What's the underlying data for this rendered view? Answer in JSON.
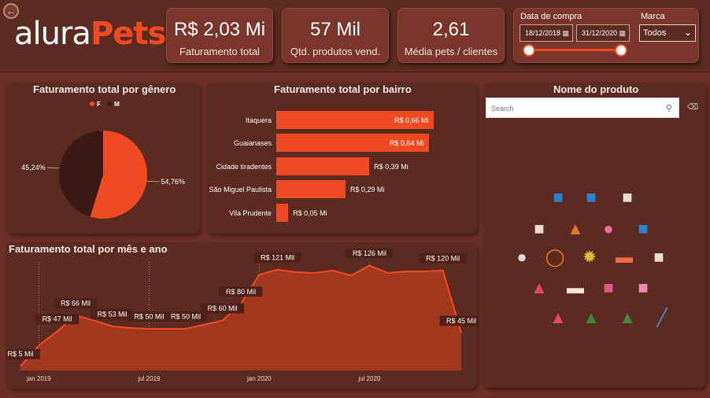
{
  "logo": {
    "part1": "alura",
    "part2": "Pets"
  },
  "kpis": [
    {
      "value": "R$ 2,03 Mi",
      "label": "Faturamento total"
    },
    {
      "value": "57 Mil",
      "label": "Qtd. produtos vend."
    },
    {
      "value": "2,61",
      "label": "Média pets / clientes"
    }
  ],
  "filters": {
    "date_label": "Data de compra",
    "date_start": "18/12/2018",
    "date_end": "31/12/2020",
    "brand_label": "Marca",
    "brand_value": "Todos",
    "date_range_fraction": [
      0.0,
      1.0
    ]
  },
  "gender_panel": {
    "title": "Faturamento total por gênero",
    "legend": [
      {
        "label": "F",
        "color": "#f04a23"
      },
      {
        "label": "M",
        "color": "#3a1813"
      }
    ],
    "slices": [
      {
        "label": "F",
        "value": 54.76,
        "text": "54,76%",
        "color": "#f04a23"
      },
      {
        "label": "M",
        "value": 45.24,
        "text": "45,24%",
        "color": "#3a1813"
      }
    ]
  },
  "bairro_panel": {
    "title": "Faturamento total por bairro",
    "rows": [
      {
        "name": "Itaquera",
        "value": 0.66,
        "text": "R$ 0,66 Mi"
      },
      {
        "name": "Guaianases",
        "value": 0.64,
        "text": "R$ 0,64 Mi"
      },
      {
        "name": "Cidade tiradentes",
        "value": 0.39,
        "text": "R$ 0,39 Mi"
      },
      {
        "name": "São Miguel Paulista",
        "value": 0.29,
        "text": "R$ 0,29 Mi"
      },
      {
        "name": "Vila Prudente",
        "value": 0.05,
        "text": "R$ 0,05 Mi"
      }
    ]
  },
  "product_panel": {
    "title": "Nome do produto",
    "search_placeholder": "Search",
    "icons": [
      "dog-food-bag-icon",
      "dog-food-bag-icon",
      "dog-treat-jar-icon",
      "dog-treat-jar-icon",
      "dog-sweater-icon",
      "pet-tag-icon",
      "dog-food-bag-icon",
      "mouse-toy-icon",
      "dog-collar-icon",
      "scratcher-ball-icon",
      "bone-treat-pack-icon",
      "dog-treat-jar-icon",
      "pet-clothing-icon",
      "bone-icon",
      "dog-treat-box-icon",
      "cat-food-box-icon",
      "pet-clothing-icon",
      "pet-costume-icon",
      "pet-costume-icon",
      "cat-wand-toy-icon"
    ]
  },
  "chart_data": {
    "type": "area",
    "title": "Faturamento total por mês e ano",
    "x_ticks": [
      "jan 2019",
      "jul 2019",
      "jan 2020",
      "jul 2020"
    ],
    "x": [
      "2018-12",
      "2019-01",
      "2019-02",
      "2019-03",
      "2019-04",
      "2019-05",
      "2019-06",
      "2019-07",
      "2019-08",
      "2019-09",
      "2019-10",
      "2019-11",
      "2019-12",
      "2020-01",
      "2020-02",
      "2020-03",
      "2020-04",
      "2020-05",
      "2020-06",
      "2020-07",
      "2020-08",
      "2020-09",
      "2020-10",
      "2020-11",
      "2020-12"
    ],
    "values": [
      5,
      30,
      47,
      66,
      60,
      53,
      51,
      50,
      50,
      50,
      55,
      60,
      80,
      115,
      121,
      118,
      117,
      120,
      114,
      126,
      117,
      119,
      119,
      120,
      45
    ],
    "labels": [
      {
        "index": 0,
        "text": "R$ 5 Mil"
      },
      {
        "index": 2,
        "text": "R$ 47 Mil"
      },
      {
        "index": 3,
        "text": "R$ 66 Mil"
      },
      {
        "index": 5,
        "text": "R$ 53 Mil"
      },
      {
        "index": 7,
        "text": "R$ 50 Mil"
      },
      {
        "index": 9,
        "text": "R$ 50 Mil"
      },
      {
        "index": 11,
        "text": "R$ 60 Mil"
      },
      {
        "index": 12,
        "text": "R$ 80 Mil"
      },
      {
        "index": 14,
        "text": "R$ 121 Mil"
      },
      {
        "index": 19,
        "text": "R$ 126 Mil"
      },
      {
        "index": 23,
        "text": "R$ 120 Mil"
      },
      {
        "index": 24,
        "text": "R$ 45 Mil"
      }
    ],
    "ylim": [
      0,
      135
    ]
  },
  "colors": {
    "accent": "#f04a23",
    "panel": "#5b2a21",
    "background": "#6b2f25"
  }
}
